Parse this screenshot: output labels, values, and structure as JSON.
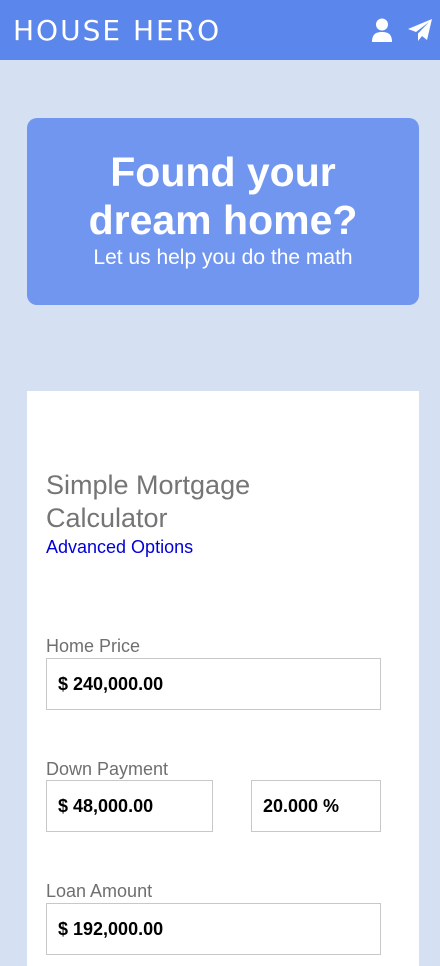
{
  "header": {
    "brand": "HOUSE HERO",
    "account_icon": "user-icon",
    "send_icon": "paper-plane-icon"
  },
  "hero": {
    "title_line1": "Found your",
    "title_line2": "dream home?",
    "subtitle": "Let us help you do the math"
  },
  "calculator": {
    "title_line1": "Simple Mortgage",
    "title_line2": "Calculator",
    "advanced_link": "Advanced Options",
    "home_price": {
      "label": "Home Price",
      "value": "$ 240,000.00"
    },
    "down_payment": {
      "label": "Down Payment",
      "amount": "$ 48,000.00",
      "percent": "20.000 %"
    },
    "loan_amount": {
      "label": "Loan Amount",
      "value": "$ 192,000.00"
    }
  },
  "colors": {
    "header_bg": "#5b86ec",
    "hero_bg": "#7196f0",
    "page_bg": "#d5e1f3",
    "link": "#0000d8"
  }
}
